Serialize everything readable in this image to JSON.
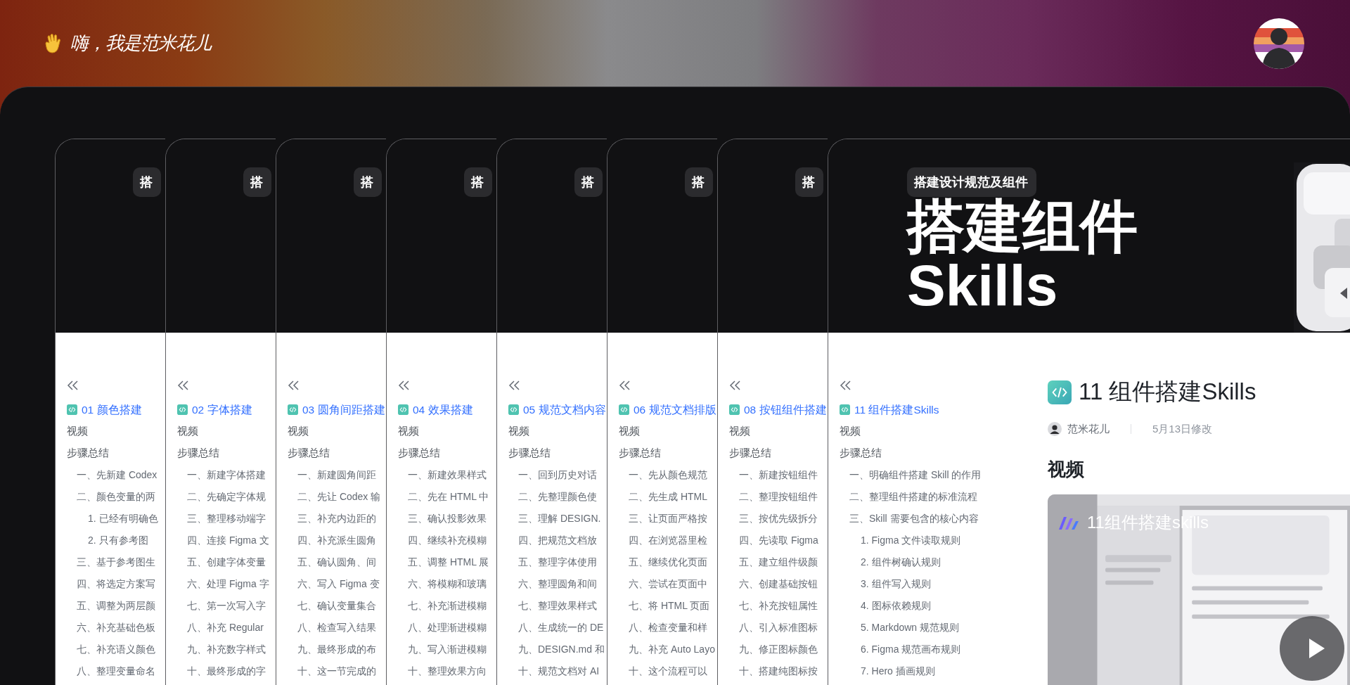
{
  "header": {
    "greeting": "嗨，我是范米花儿"
  },
  "cards": [
    {
      "badge": "搭",
      "nav_title": "01 颜色搭建",
      "video_link": "视频",
      "steps_link": "步骤总结",
      "steps": [
        {
          "text": "一、先新建 Codex"
        },
        {
          "text": "二、颜色变量的两",
          "children": [
            {
              "text": "1. 已经有明确色"
            },
            {
              "text": "2. 只有参考图"
            }
          ]
        },
        {
          "text": "三、基于参考图生"
        },
        {
          "text": "四、将选定方案写"
        },
        {
          "text": "五、调整为两层颜"
        },
        {
          "text": "六、补充基础色板"
        },
        {
          "text": "七、补充语义颜色"
        },
        {
          "text": "八、整理变量命名"
        }
      ]
    },
    {
      "badge": "搭",
      "nav_title": "02 字体搭建",
      "video_link": "视频",
      "steps_link": "步骤总结",
      "steps": [
        {
          "text": "一、新建字体搭建"
        },
        {
          "text": "二、先确定字体规"
        },
        {
          "text": "三、整理移动端字"
        },
        {
          "text": "四、连接 Figma 文"
        },
        {
          "text": "五、创建字体变量"
        },
        {
          "text": "六、处理 Figma 字"
        },
        {
          "text": "七、第一次写入字"
        },
        {
          "text": "八、补充 Regular"
        },
        {
          "text": "九、补充数字样式"
        },
        {
          "text": "十、最终形成的字"
        }
      ]
    },
    {
      "badge": "搭",
      "nav_title": "03 圆角间距搭建",
      "video_link": "视频",
      "steps_link": "步骤总结",
      "steps": [
        {
          "text": "一、新建圆角间距"
        },
        {
          "text": "二、先让 Codex 输"
        },
        {
          "text": "三、补充内边距的"
        },
        {
          "text": "四、补充派生圆角"
        },
        {
          "text": "五、确认圆角、间"
        },
        {
          "text": "六、写入 Figma 变"
        },
        {
          "text": "七、确认变量集合"
        },
        {
          "text": "八、检查写入结果"
        },
        {
          "text": "九、最终形成的布"
        },
        {
          "text": "十、这一节完成的"
        }
      ]
    },
    {
      "badge": "搭",
      "nav_title": "04 效果搭建",
      "video_link": "视频",
      "steps_link": "步骤总结",
      "steps": [
        {
          "text": "一、新建效果样式"
        },
        {
          "text": "二、先在 HTML 中"
        },
        {
          "text": "三、确认投影效果"
        },
        {
          "text": "四、继续补充模糊"
        },
        {
          "text": "五、调整 HTML 展"
        },
        {
          "text": "六、将模糊和玻璃"
        },
        {
          "text": "七、补充渐进模糊"
        },
        {
          "text": "八、处理渐进模糊"
        },
        {
          "text": "九、写入渐进模糊"
        },
        {
          "text": "十、整理效果方向"
        }
      ]
    },
    {
      "badge": "搭",
      "nav_title": "05 规范文档内容",
      "video_link": "视频",
      "steps_link": "步骤总结",
      "steps": [
        {
          "text": "一、回到历史对话"
        },
        {
          "text": "二、先整理颜色使"
        },
        {
          "text": "三、理解 DESIGN."
        },
        {
          "text": "四、把规范文档放"
        },
        {
          "text": "五、整理字体使用"
        },
        {
          "text": "六、整理圆角和间"
        },
        {
          "text": "七、整理效果样式"
        },
        {
          "text": "八、生成统一的 DE"
        },
        {
          "text": "九、DESIGN.md 和"
        },
        {
          "text": "十、规范文档对 AI"
        }
      ]
    },
    {
      "badge": "搭",
      "nav_title": "06 规范文档排版",
      "video_link": "视频",
      "steps_link": "步骤总结",
      "steps": [
        {
          "text": "一、先从颜色规范"
        },
        {
          "text": "二、先生成 HTML"
        },
        {
          "text": "三、让页面严格按"
        },
        {
          "text": "四、在浏览器里检"
        },
        {
          "text": "五、继续优化页面"
        },
        {
          "text": "六、尝试在页面中"
        },
        {
          "text": "七、将 HTML 页面"
        },
        {
          "text": "八、检查变量和样"
        },
        {
          "text": "九、补充 Auto Layo"
        },
        {
          "text": "十、这个流程可以"
        }
      ]
    },
    {
      "badge": "搭",
      "nav_title": "08 按钮组件搭建",
      "video_link": "视频",
      "steps_link": "步骤总结",
      "steps": [
        {
          "text": "一、新建按钮组件"
        },
        {
          "text": "二、整理按钮组件"
        },
        {
          "text": "三、按优先级拆分"
        },
        {
          "text": "四、先读取 Figma"
        },
        {
          "text": "五、建立组件级颜"
        },
        {
          "text": "六、创建基础按钮"
        },
        {
          "text": "七、补充按钮属性"
        },
        {
          "text": "八、引入标准图标"
        },
        {
          "text": "九、修正图标颜色"
        },
        {
          "text": "十、搭建纯图标按"
        }
      ]
    },
    {
      "badge": "搭建设计规范及组件",
      "title_lines": [
        "搭建组件",
        "Skills"
      ],
      "cover_picture": {
        "kind": "picture"
      },
      "nav_title": "11 组件搭建Skills",
      "video_link": "视频",
      "steps_link": "步骤总结",
      "steps": [
        {
          "text": "一、明确组件搭建 Skill 的作用"
        },
        {
          "text": "二、整理组件搭建的标准流程"
        },
        {
          "text": "三、Skill 需要包含的核心内容",
          "children": [
            {
              "text": "1. Figma 文件读取规则"
            },
            {
              "text": "2. 组件树确认规则"
            },
            {
              "text": "3. 组件写入规则"
            },
            {
              "text": "4. 图标依赖规则"
            },
            {
              "text": "5. Markdown 规范规则"
            },
            {
              "text": "6. Figma 规范画布规则"
            },
            {
              "text": "7. Hero 插画规则"
            }
          ]
        }
      ],
      "document": {
        "title": "11 组件搭建Skills",
        "author": "范米花儿",
        "modified": "5月13日修改",
        "section_heading": "视频",
        "video": {
          "kind": "picture",
          "title": "11组件搭建skills"
        }
      }
    }
  ]
}
